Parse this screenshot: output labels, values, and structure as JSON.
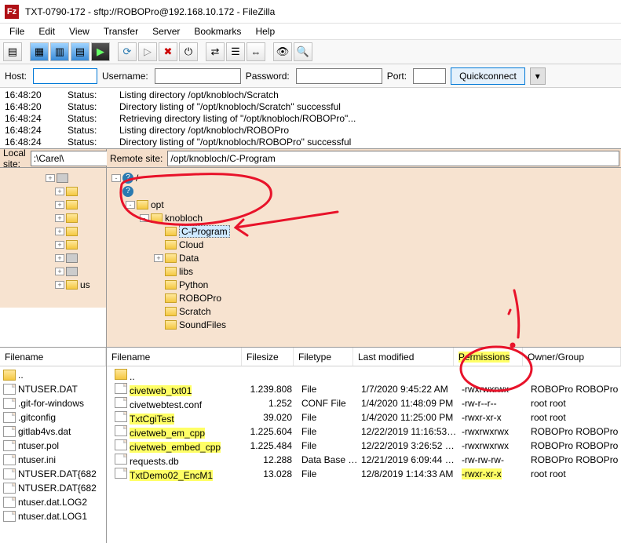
{
  "window": {
    "title": "TXT-0790-172 - sftp://ROBOPro@192.168.10.172 - FileZilla"
  },
  "menu": {
    "file": "File",
    "edit": "Edit",
    "view": "View",
    "transfer": "Transfer",
    "server": "Server",
    "bookmarks": "Bookmarks",
    "help": "Help"
  },
  "qc": {
    "host_label": "Host:",
    "user_label": "Username:",
    "pass_label": "Password:",
    "port_label": "Port:",
    "btn": "Quickconnect",
    "host": "",
    "user": "",
    "pass": "",
    "port": ""
  },
  "log": [
    {
      "t": "16:48:20",
      "s": "Status:",
      "m": "Listing directory /opt/knobloch/Scratch"
    },
    {
      "t": "16:48:20",
      "s": "Status:",
      "m": "Directory listing of \"/opt/knobloch/Scratch\" successful"
    },
    {
      "t": "16:48:24",
      "s": "Status:",
      "m": "Retrieving directory listing of \"/opt/knobloch/ROBOPro\"..."
    },
    {
      "t": "16:48:24",
      "s": "Status:",
      "m": "Listing directory /opt/knobloch/ROBOPro"
    },
    {
      "t": "16:48:24",
      "s": "Status:",
      "m": "Directory listing of \"/opt/knobloch/ROBOPro\" successful"
    }
  ],
  "local": {
    "label": "Local site:",
    "path": ":\\Carel\\",
    "tree": [
      "",
      "",
      "",
      "",
      "",
      "",
      "",
      "",
      "us"
    ]
  },
  "remote": {
    "label": "Remote site:",
    "path": "/opt/knobloch/C-Program",
    "tree": {
      "root": "/",
      "opt": "opt",
      "knobloch": "knobloch",
      "children": [
        "C-Program",
        "Cloud",
        "Data",
        "libs",
        "Python",
        "ROBOPro",
        "Scratch",
        "SoundFiles"
      ]
    }
  },
  "local_list": {
    "header": "Filename",
    "rows": [
      "..",
      "NTUSER.DAT",
      ".git-for-windows",
      ".gitconfig",
      "gitlab4vs.dat",
      "ntuser.pol",
      "ntuser.ini",
      "NTUSER.DAT{682",
      "NTUSER.DAT{682",
      "ntuser.dat.LOG2",
      "ntuser.dat.LOG1"
    ]
  },
  "remote_list": {
    "headers": {
      "name": "Filename",
      "size": "Filesize",
      "type": "Filetype",
      "mod": "Last modified",
      "perm": "Permissions",
      "own": "Owner/Group"
    },
    "rows": [
      {
        "name": "..",
        "size": "",
        "type": "",
        "mod": "",
        "perm": "",
        "own": "",
        "up": true
      },
      {
        "name": "civetweb_txt01",
        "size": "1.239.808",
        "type": "File",
        "mod": "1/7/2020 9:45:22 AM",
        "perm": "-rwxrwxrwx",
        "own": "ROBOPro ROBOPro",
        "hl": true
      },
      {
        "name": "civetwebtest.conf",
        "size": "1.252",
        "type": "CONF File",
        "mod": "1/4/2020 11:48:09 PM",
        "perm": "-rw-r--r--",
        "own": "root root"
      },
      {
        "name": "TxtCgiTest",
        "size": "39.020",
        "type": "File",
        "mod": "1/4/2020 11:25:00 PM",
        "perm": "-rwxr-xr-x",
        "own": "root root",
        "hl": true
      },
      {
        "name": "civetweb_em_cpp",
        "size": "1.225.604",
        "type": "File",
        "mod": "12/22/2019 11:16:53…",
        "perm": "-rwxrwxrwx",
        "own": "ROBOPro ROBOPro",
        "hl": true
      },
      {
        "name": "civetweb_embed_cpp",
        "size": "1.225.484",
        "type": "File",
        "mod": "12/22/2019 3:26:52 …",
        "perm": "-rwxrwxrwx",
        "own": "ROBOPro ROBOPro",
        "hl": true
      },
      {
        "name": "requests.db",
        "size": "12.288",
        "type": "Data Base …",
        "mod": "12/21/2019 6:09:44 …",
        "perm": "-rw-rw-rw-",
        "own": "ROBOPro ROBOPro"
      },
      {
        "name": "TxtDemo02_EncM1",
        "size": "13.028",
        "type": "File",
        "mod": "12/8/2019 1:14:33 AM",
        "perm": "-rwxr-xr-x",
        "own": "root root",
        "hl": true,
        "hlperm": true
      }
    ]
  }
}
